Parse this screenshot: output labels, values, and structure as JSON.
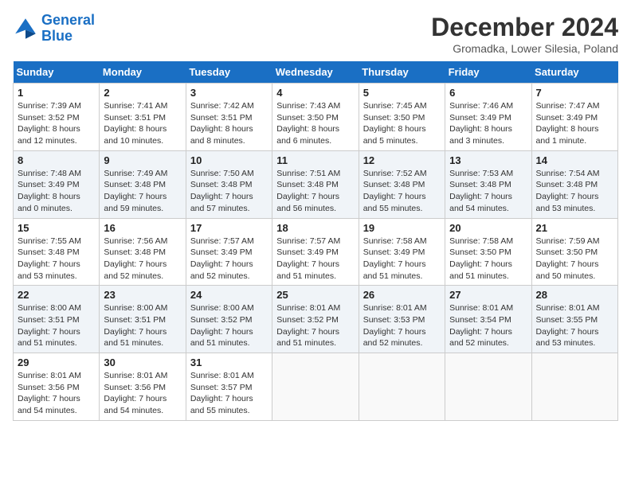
{
  "header": {
    "logo_line1": "General",
    "logo_line2": "Blue",
    "month_title": "December 2024",
    "location": "Gromadka, Lower Silesia, Poland"
  },
  "weekdays": [
    "Sunday",
    "Monday",
    "Tuesday",
    "Wednesday",
    "Thursday",
    "Friday",
    "Saturday"
  ],
  "weeks": [
    [
      {
        "day": "1",
        "sunrise": "7:39 AM",
        "sunset": "3:52 PM",
        "daylight": "8 hours and 12 minutes."
      },
      {
        "day": "2",
        "sunrise": "7:41 AM",
        "sunset": "3:51 PM",
        "daylight": "8 hours and 10 minutes."
      },
      {
        "day": "3",
        "sunrise": "7:42 AM",
        "sunset": "3:51 PM",
        "daylight": "8 hours and 8 minutes."
      },
      {
        "day": "4",
        "sunrise": "7:43 AM",
        "sunset": "3:50 PM",
        "daylight": "8 hours and 6 minutes."
      },
      {
        "day": "5",
        "sunrise": "7:45 AM",
        "sunset": "3:50 PM",
        "daylight": "8 hours and 5 minutes."
      },
      {
        "day": "6",
        "sunrise": "7:46 AM",
        "sunset": "3:49 PM",
        "daylight": "8 hours and 3 minutes."
      },
      {
        "day": "7",
        "sunrise": "7:47 AM",
        "sunset": "3:49 PM",
        "daylight": "8 hours and 1 minute."
      }
    ],
    [
      {
        "day": "8",
        "sunrise": "7:48 AM",
        "sunset": "3:49 PM",
        "daylight": "8 hours and 0 minutes."
      },
      {
        "day": "9",
        "sunrise": "7:49 AM",
        "sunset": "3:48 PM",
        "daylight": "7 hours and 59 minutes."
      },
      {
        "day": "10",
        "sunrise": "7:50 AM",
        "sunset": "3:48 PM",
        "daylight": "7 hours and 57 minutes."
      },
      {
        "day": "11",
        "sunrise": "7:51 AM",
        "sunset": "3:48 PM",
        "daylight": "7 hours and 56 minutes."
      },
      {
        "day": "12",
        "sunrise": "7:52 AM",
        "sunset": "3:48 PM",
        "daylight": "7 hours and 55 minutes."
      },
      {
        "day": "13",
        "sunrise": "7:53 AM",
        "sunset": "3:48 PM",
        "daylight": "7 hours and 54 minutes."
      },
      {
        "day": "14",
        "sunrise": "7:54 AM",
        "sunset": "3:48 PM",
        "daylight": "7 hours and 53 minutes."
      }
    ],
    [
      {
        "day": "15",
        "sunrise": "7:55 AM",
        "sunset": "3:48 PM",
        "daylight": "7 hours and 53 minutes."
      },
      {
        "day": "16",
        "sunrise": "7:56 AM",
        "sunset": "3:48 PM",
        "daylight": "7 hours and 52 minutes."
      },
      {
        "day": "17",
        "sunrise": "7:57 AM",
        "sunset": "3:49 PM",
        "daylight": "7 hours and 52 minutes."
      },
      {
        "day": "18",
        "sunrise": "7:57 AM",
        "sunset": "3:49 PM",
        "daylight": "7 hours and 51 minutes."
      },
      {
        "day": "19",
        "sunrise": "7:58 AM",
        "sunset": "3:49 PM",
        "daylight": "7 hours and 51 minutes."
      },
      {
        "day": "20",
        "sunrise": "7:58 AM",
        "sunset": "3:50 PM",
        "daylight": "7 hours and 51 minutes."
      },
      {
        "day": "21",
        "sunrise": "7:59 AM",
        "sunset": "3:50 PM",
        "daylight": "7 hours and 50 minutes."
      }
    ],
    [
      {
        "day": "22",
        "sunrise": "8:00 AM",
        "sunset": "3:51 PM",
        "daylight": "7 hours and 51 minutes."
      },
      {
        "day": "23",
        "sunrise": "8:00 AM",
        "sunset": "3:51 PM",
        "daylight": "7 hours and 51 minutes."
      },
      {
        "day": "24",
        "sunrise": "8:00 AM",
        "sunset": "3:52 PM",
        "daylight": "7 hours and 51 minutes."
      },
      {
        "day": "25",
        "sunrise": "8:01 AM",
        "sunset": "3:52 PM",
        "daylight": "7 hours and 51 minutes."
      },
      {
        "day": "26",
        "sunrise": "8:01 AM",
        "sunset": "3:53 PM",
        "daylight": "7 hours and 52 minutes."
      },
      {
        "day": "27",
        "sunrise": "8:01 AM",
        "sunset": "3:54 PM",
        "daylight": "7 hours and 52 minutes."
      },
      {
        "day": "28",
        "sunrise": "8:01 AM",
        "sunset": "3:55 PM",
        "daylight": "7 hours and 53 minutes."
      }
    ],
    [
      {
        "day": "29",
        "sunrise": "8:01 AM",
        "sunset": "3:56 PM",
        "daylight": "7 hours and 54 minutes."
      },
      {
        "day": "30",
        "sunrise": "8:01 AM",
        "sunset": "3:56 PM",
        "daylight": "7 hours and 54 minutes."
      },
      {
        "day": "31",
        "sunrise": "8:01 AM",
        "sunset": "3:57 PM",
        "daylight": "7 hours and 55 minutes."
      },
      null,
      null,
      null,
      null
    ]
  ]
}
